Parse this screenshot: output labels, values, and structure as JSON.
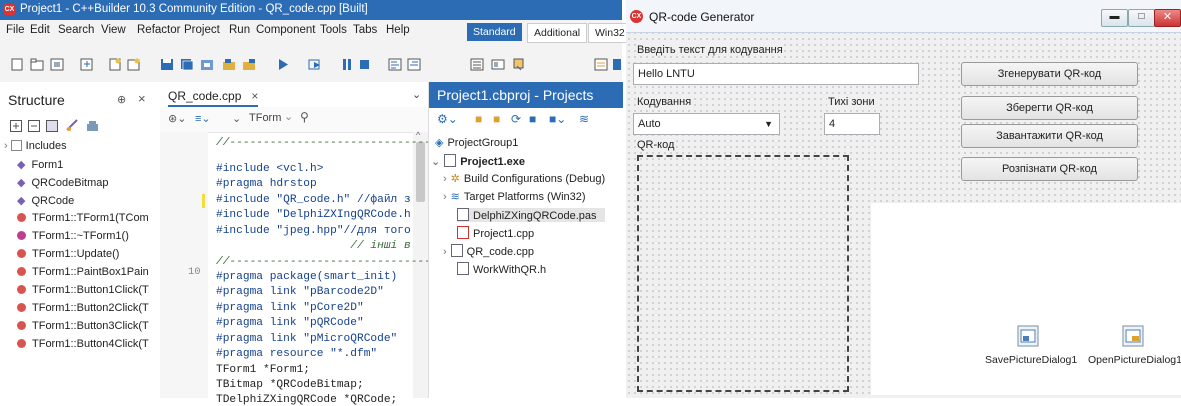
{
  "ide": {
    "title": "Project1 - C++Builder 10.3 Community Edition - QR_code.cpp [Built]",
    "menu": [
      "File",
      "Edit",
      "Search",
      "View",
      "Refactor",
      "Project",
      "Run",
      "Component",
      "Tools",
      "Tabs",
      "Help"
    ],
    "palette_tabs": [
      "Standard",
      "Additional",
      "Win32"
    ],
    "structure": {
      "title": "Structure",
      "items": [
        "Includes",
        "Form1",
        "QRCodeBitmap",
        "QRCode",
        "TForm1::TForm1(TCom",
        "TForm1::~TForm1()",
        "TForm1::Update()",
        "TForm1::PaintBox1Pain",
        "TForm1::Button1Click(T",
        "TForm1::Button2Click(T",
        "TForm1::Button3Click(T",
        "TForm1::Button4Click(T"
      ]
    },
    "editor": {
      "tab": "QR_code.cpp",
      "scope": "TForm",
      "line_number": "10",
      "lines": [
        "//-----------------------------------",
        "#include <vcl.h>",
        "#pragma hdrstop",
        "#include \"QR_code.h\" //файл з",
        "#include \"DelphiZXIngQRCode.h",
        "#include \"jpeg.hpp\"//для того",
        "                    // інші в",
        "//-----------------------------------",
        "#pragma package(smart_init)",
        "#pragma link \"pBarcode2D\"",
        "#pragma link \"pCore2D\"",
        "#pragma link \"pQRCode\"",
        "#pragma link \"pMicroQRCode\"",
        "#pragma resource \"*.dfm\"",
        "TForm1 *Form1;",
        "TBitmap *QRCodeBitmap;",
        "TDelphiZXingQRCode *QRCode;"
      ]
    },
    "projects": {
      "title": "Project1.cbproj - Projects",
      "items": [
        "ProjectGroup1",
        "Project1.exe",
        "Build Configurations (Debug)",
        "Target Platforms (Win32)",
        "DelphiZXingQRCode.pas",
        "Project1.cpp",
        "QR_code.cpp",
        "WorkWithQR.h"
      ]
    }
  },
  "form": {
    "title": "QR-code Generator",
    "input_label": "Введіть текст для кодування",
    "input_value": "Hello LNTU",
    "encoding_label": "Кодування",
    "encoding_value": "Auto",
    "quiet_label": "Тихі зони",
    "quiet_value": "4",
    "qr_label": "QR-код",
    "buttons": [
      "Згенерувати QR-код",
      "Зберегти QR-код",
      "Завантажити QR-код",
      "Розпізнати QR-код"
    ],
    "dialogs": [
      "SavePictureDialog1",
      "OpenPictureDialog1"
    ]
  }
}
